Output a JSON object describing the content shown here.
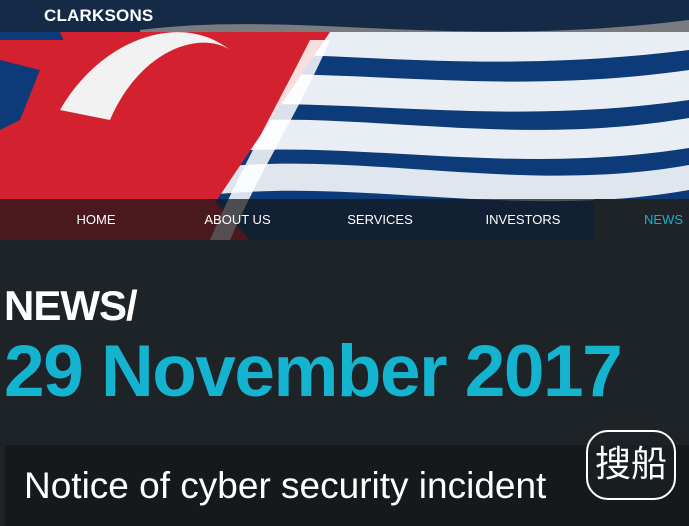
{
  "header": {
    "brand": "CLARKSONS"
  },
  "nav": {
    "items": [
      {
        "label": "HOME",
        "active": false
      },
      {
        "label": "ABOUT US",
        "active": false
      },
      {
        "label": "SERVICES",
        "active": false
      },
      {
        "label": "INVESTORS",
        "active": false
      },
      {
        "label": "NEWS",
        "active": true
      }
    ]
  },
  "page": {
    "section": "NEWS/",
    "date": "29 November 2017",
    "headline": "Notice of cyber security incident"
  },
  "watermark": {
    "text": "搜船"
  },
  "colors": {
    "accent": "#14b3cf",
    "background": "#1e2327",
    "flag_red": "#d3212f",
    "flag_blue": "#0d3a78"
  }
}
